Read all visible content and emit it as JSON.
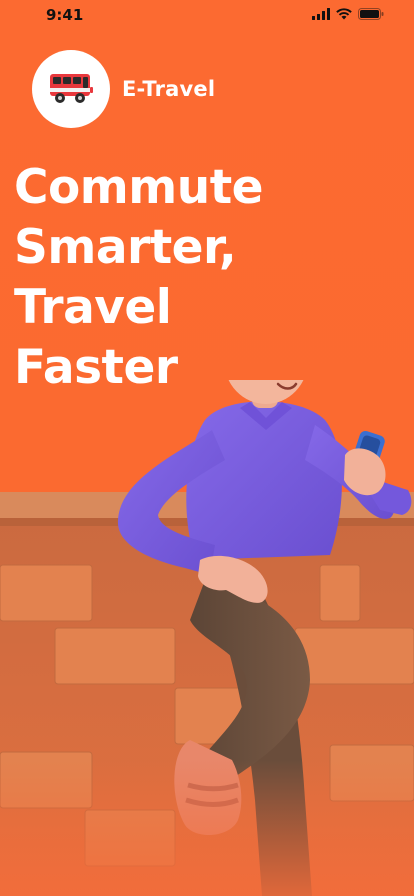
{
  "status_bar": {
    "time": "9:41"
  },
  "brand": {
    "name": "E-Travel",
    "logo_icon": "bus-icon"
  },
  "headline": {
    "lines": [
      "Commute",
      "Smarter,",
      "Travel",
      "Faster"
    ]
  },
  "colors": {
    "background": "#fb6a30",
    "text": "#ffffff",
    "shirt": "#7b5de0",
    "wall": "#c9683d"
  }
}
